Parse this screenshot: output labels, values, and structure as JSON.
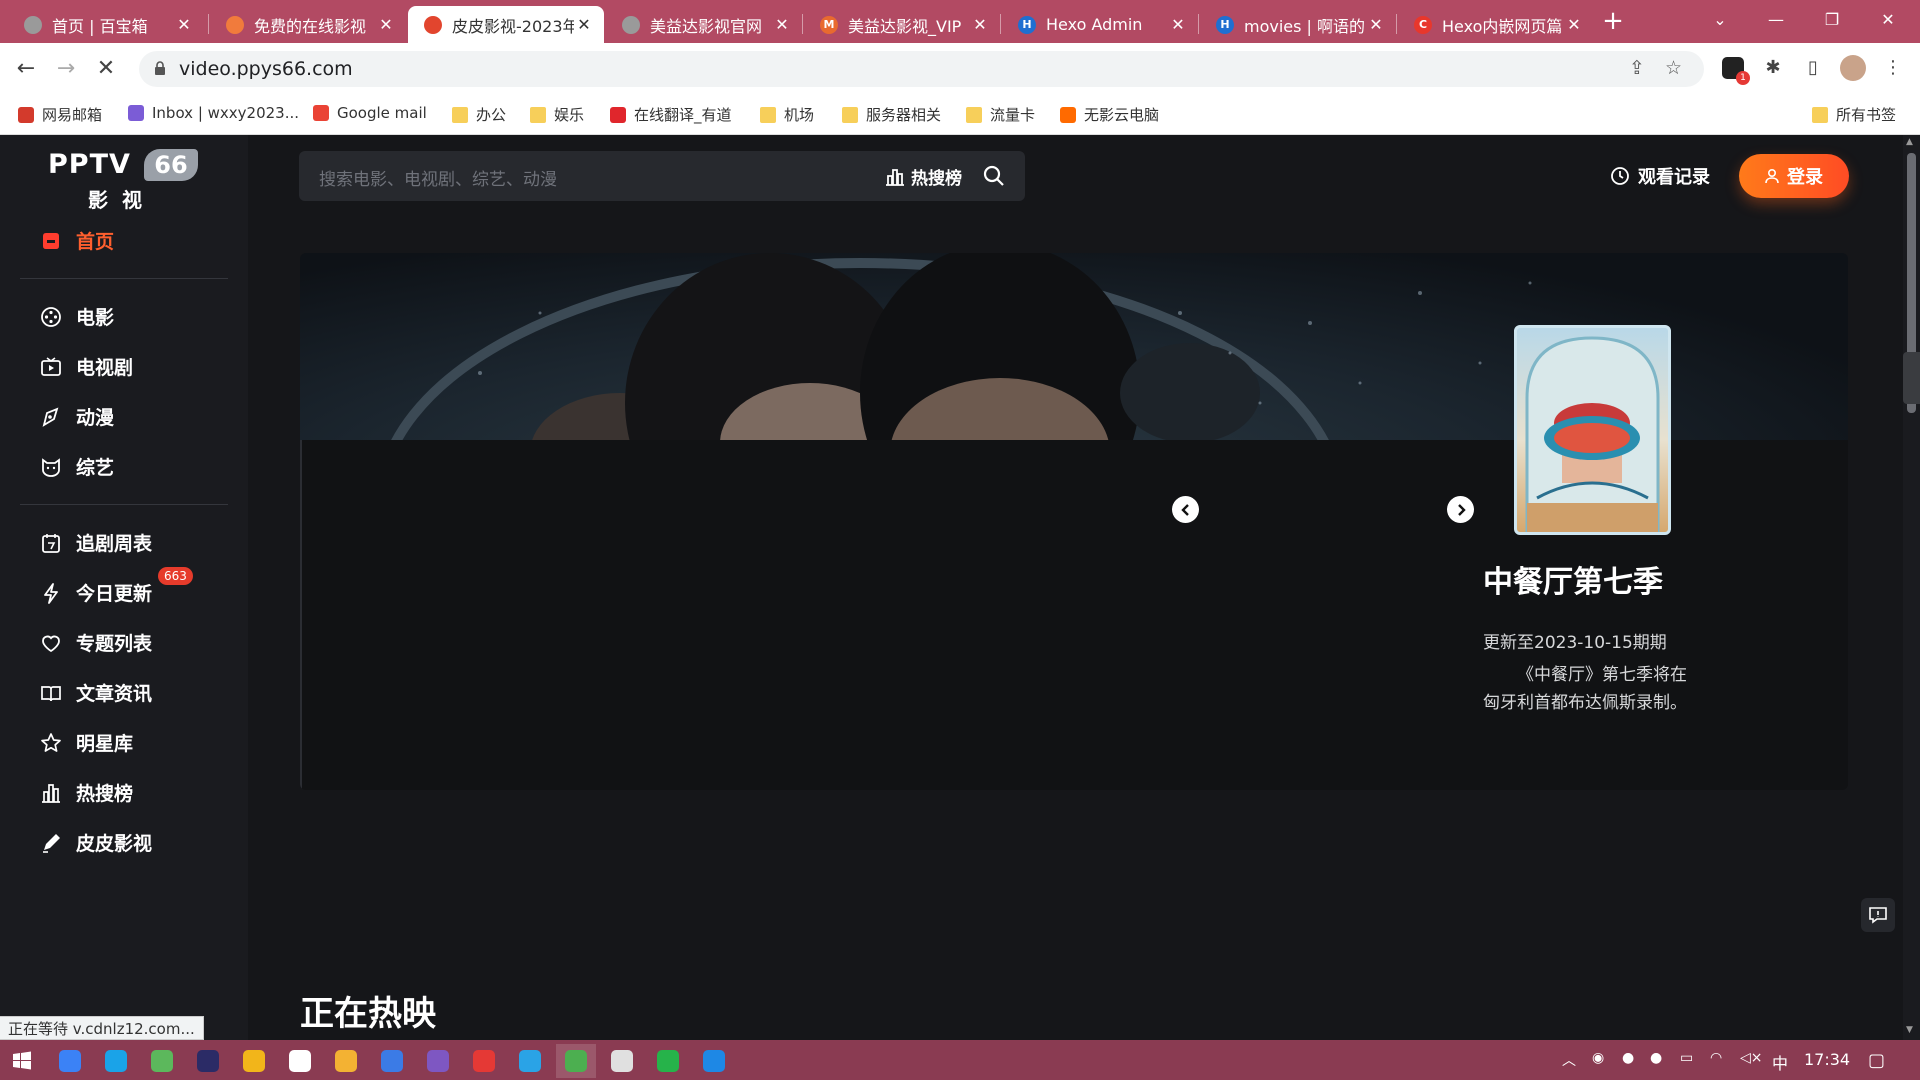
{
  "browser": {
    "tabs": [
      {
        "title": "首页 | 百宝箱",
        "fav_color": "#9a9a9a",
        "fav_glyph": ""
      },
      {
        "title": "免费的在线影视",
        "fav_color": "#f17b3c",
        "fav_glyph": ""
      },
      {
        "title": "皮皮影视-2023年",
        "fav_color": "#e2452e",
        "fav_glyph": ""
      },
      {
        "title": "美益达影视官网",
        "fav_color": "#9a9a9a",
        "fav_glyph": ""
      },
      {
        "title": "美益达影视_VIP",
        "fav_color": "#e86a2f",
        "fav_glyph": "M"
      },
      {
        "title": "Hexo Admin",
        "fav_color": "#1f6fd1",
        "fav_glyph": "H"
      },
      {
        "title": "movies | 啊语的",
        "fav_color": "#1f6fd1",
        "fav_glyph": "H"
      },
      {
        "title": "Hexo内嵌网页篇",
        "fav_color": "#e8372c",
        "fav_glyph": "C"
      }
    ],
    "active_tab_index": 2,
    "url": "video.ppys66.com",
    "bookmarks": [
      {
        "label": "网易邮箱",
        "icon": "netease-icon",
        "color": "#d33a2c"
      },
      {
        "label": "Inbox | wxxy2023...",
        "icon": "mail-icon",
        "color": "#7b5cd6"
      },
      {
        "label": "Google mail",
        "icon": "gmail-icon",
        "color": "#ea4335"
      },
      {
        "label": "办公",
        "icon": "folder-icon",
        "color": "#f7cf5a"
      },
      {
        "label": "娱乐",
        "icon": "folder-icon",
        "color": "#f7cf5a"
      },
      {
        "label": "在线翻译_有道",
        "icon": "youdao-icon",
        "color": "#e0262c"
      },
      {
        "label": "机场",
        "icon": "folder-icon",
        "color": "#f7cf5a"
      },
      {
        "label": "服务器相关",
        "icon": "folder-icon",
        "color": "#f7cf5a"
      },
      {
        "label": "流量卡",
        "icon": "folder-icon",
        "color": "#f7cf5a"
      },
      {
        "label": "无影云电脑",
        "icon": "cloud-pc-icon",
        "color": "#ff6a00"
      }
    ],
    "all_bookmarks": "所有书签",
    "status_text": "正在等待 v.cdnlz12.com..."
  },
  "site": {
    "logo_main": "PPTV",
    "logo_num": "66",
    "logo_sub": "影视",
    "nav_home": "首页",
    "nav_categories": [
      {
        "label": "电影",
        "icon": "film-icon"
      },
      {
        "label": "电视剧",
        "icon": "tv-icon"
      },
      {
        "label": "动漫",
        "icon": "anime-icon"
      },
      {
        "label": "综艺",
        "icon": "variety-icon"
      }
    ],
    "nav_more": [
      {
        "label": "追剧周表",
        "icon": "calendar-icon"
      },
      {
        "label": "今日更新",
        "icon": "lightning-icon"
      },
      {
        "label": "专题列表",
        "icon": "heart-icon"
      },
      {
        "label": "文章资讯",
        "icon": "book-icon"
      },
      {
        "label": "明星库",
        "icon": "star-icon"
      },
      {
        "label": "热搜榜",
        "icon": "chart-icon"
      },
      {
        "label": "皮皮影视",
        "icon": "pencil-icon"
      }
    ],
    "update_badge": "663",
    "search_placeholder": "搜索电影、电视剧、综艺、动漫",
    "hot_search": "热搜榜",
    "history": "观看记录",
    "login": "登录",
    "featured": {
      "title": "中餐厅第七季",
      "update": "更新至2023-10-15期期",
      "desc": "《中餐厅》第七季将在匈牙利首都布达佩斯录制。"
    },
    "section_now_showing": "正在热映"
  },
  "taskbar": {
    "clock": "17:34",
    "ime": "中",
    "apps": [
      "#3b82f6",
      "#1aa3e8",
      "#5cb85c",
      "#2b2b66",
      "#f2b51a",
      "#ffffff",
      "#f3b233",
      "#3b7be6",
      "#7e57c2",
      "#e53935",
      "#2aa3e6",
      "#4caf50",
      "#e0e0e0",
      "#26b34a",
      "#1e88e5"
    ]
  }
}
